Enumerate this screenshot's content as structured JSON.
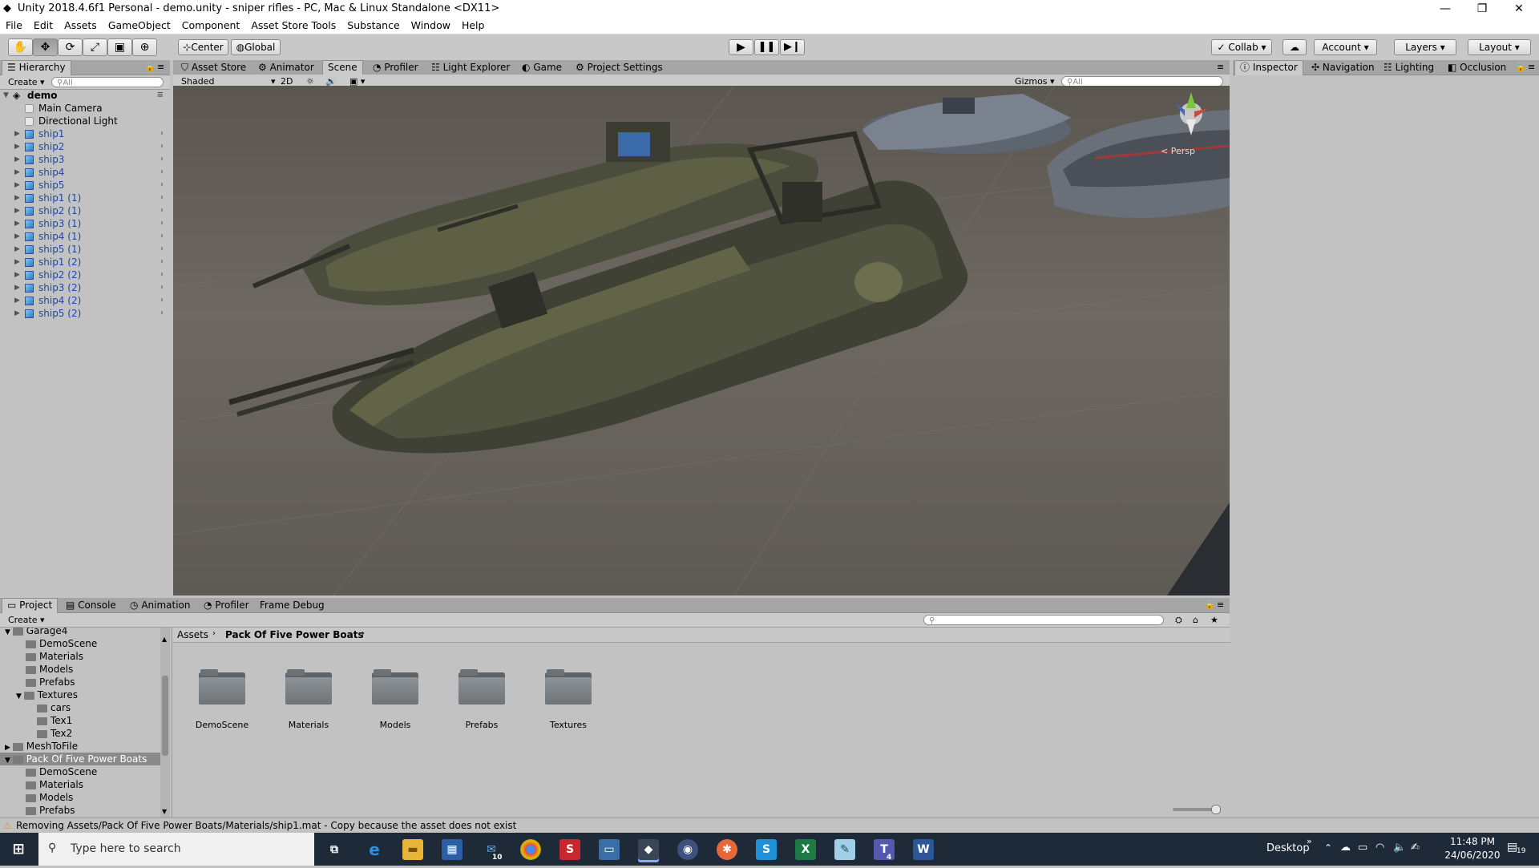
{
  "window": {
    "title": "Unity 2018.4.6f1 Personal - demo.unity - sniper rifles - PC, Mac & Linux Standalone <DX11>"
  },
  "menu": [
    "File",
    "Edit",
    "Assets",
    "GameObject",
    "Component",
    "Asset Store Tools",
    "Substance",
    "Window",
    "Help"
  ],
  "toolbar": {
    "pivot": "Center",
    "space": "Global",
    "collab": "Collab",
    "account": "Account",
    "layers": "Layers",
    "layout": "Layout"
  },
  "hierarchy": {
    "tab": "Hierarchy",
    "create": "Create",
    "search_placeholder": "All",
    "scene_name": "demo",
    "items": [
      {
        "name": "Main Camera",
        "type": "plain"
      },
      {
        "name": "Directional Light",
        "type": "plain"
      },
      {
        "name": "ship1",
        "type": "prefab"
      },
      {
        "name": "ship2",
        "type": "prefab"
      },
      {
        "name": "ship3",
        "type": "prefab"
      },
      {
        "name": "ship4",
        "type": "prefab"
      },
      {
        "name": "ship5",
        "type": "prefab"
      },
      {
        "name": "ship1 (1)",
        "type": "prefab"
      },
      {
        "name": "ship2 (1)",
        "type": "prefab"
      },
      {
        "name": "ship3 (1)",
        "type": "prefab"
      },
      {
        "name": "ship4 (1)",
        "type": "prefab"
      },
      {
        "name": "ship5 (1)",
        "type": "prefab"
      },
      {
        "name": "ship1 (2)",
        "type": "prefab"
      },
      {
        "name": "ship2 (2)",
        "type": "prefab"
      },
      {
        "name": "ship3 (2)",
        "type": "prefab"
      },
      {
        "name": "ship4 (2)",
        "type": "prefab"
      },
      {
        "name": "ship5 (2)",
        "type": "prefab"
      }
    ]
  },
  "center_tabs": [
    "Asset Store",
    "Animator",
    "Scene",
    "Profiler",
    "Light Explorer",
    "Game",
    "Project Settings"
  ],
  "scene_bar": {
    "shading": "Shaded",
    "mode2d": "2D",
    "gizmos": "Gizmos",
    "search_placeholder": "All",
    "persp": "< Persp"
  },
  "right_tabs": [
    "Inspector",
    "Navigation",
    "Lighting",
    "Occlusion"
  ],
  "bottom_tabs": [
    "Project",
    "Console",
    "Animation",
    "Profiler",
    "Frame Debug"
  ],
  "project": {
    "create": "Create",
    "tree": [
      {
        "name": "Garage4",
        "depth": 1,
        "expanded": true
      },
      {
        "name": "DemoScene",
        "depth": 2
      },
      {
        "name": "Materials",
        "depth": 2
      },
      {
        "name": "Models",
        "depth": 2
      },
      {
        "name": "Prefabs",
        "depth": 2
      },
      {
        "name": "Textures",
        "depth": 2,
        "expanded": true
      },
      {
        "name": "cars",
        "depth": 3
      },
      {
        "name": "Tex1",
        "depth": 3
      },
      {
        "name": "Tex2",
        "depth": 3
      },
      {
        "name": "MeshToFile",
        "depth": 1,
        "collapsed": true
      },
      {
        "name": "Pack Of Five Power Boats",
        "depth": 1,
        "expanded": true,
        "selected": true
      },
      {
        "name": "DemoScene",
        "depth": 2
      },
      {
        "name": "Materials",
        "depth": 2
      },
      {
        "name": "Models",
        "depth": 2
      },
      {
        "name": "Prefabs",
        "depth": 2
      }
    ],
    "breadcrumb": [
      "Assets",
      "Pack Of Five Power Boats"
    ],
    "folders": [
      "DemoScene",
      "Materials",
      "Models",
      "Prefabs",
      "Textures"
    ]
  },
  "status": {
    "message": "Removing Assets/Pack Of Five Power Boats/Materials/ship1.mat - Copy because the asset does not exist"
  },
  "taskbar": {
    "search_placeholder": "Type here to search",
    "desktop_label": "Desktop",
    "time": "11:48 PM",
    "date": "24/06/2020",
    "notification_count": "19",
    "mail_badge": "10",
    "teams_badge": "4"
  }
}
